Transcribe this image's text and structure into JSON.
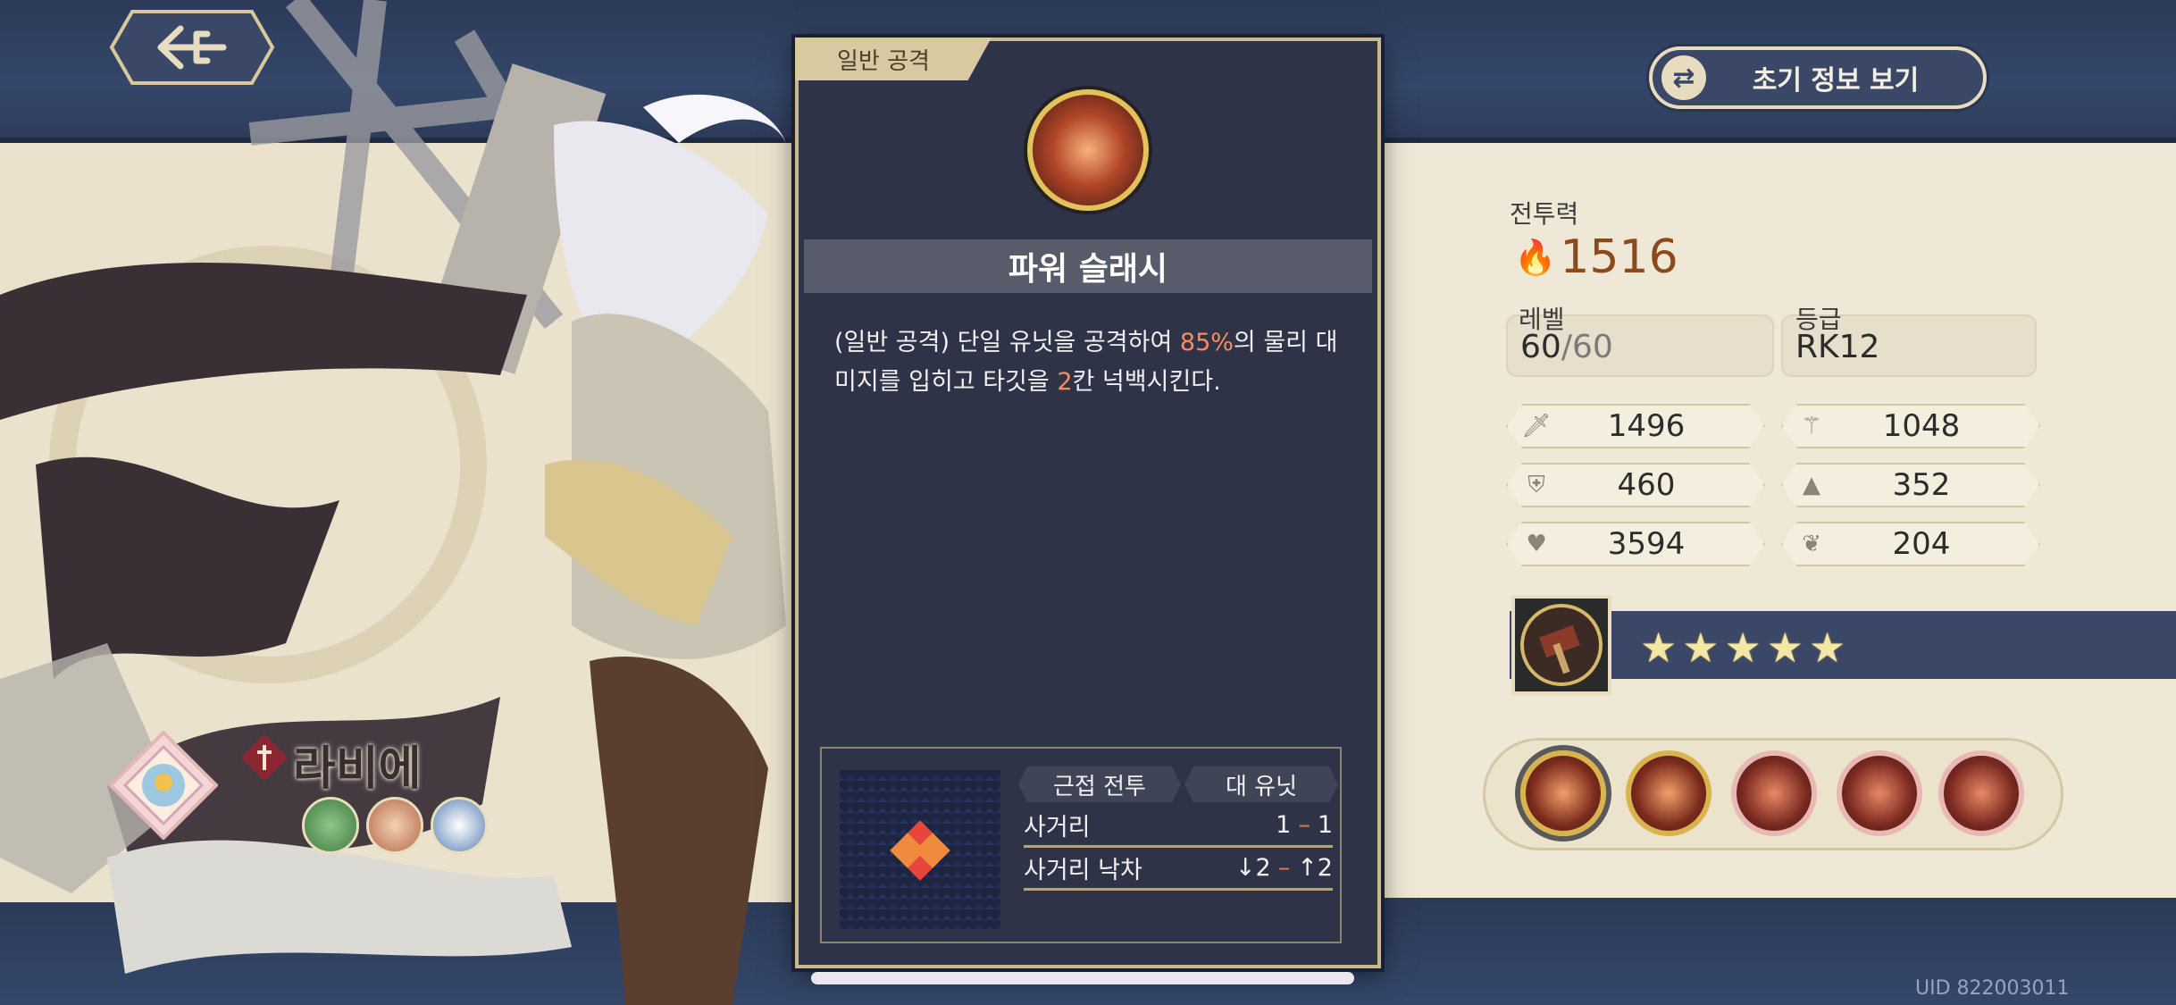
{
  "header": {
    "back_icon": "trident-arrow-icon",
    "init_button": {
      "icon": "swap-arrows-icon",
      "label": "초기 정보 보기"
    }
  },
  "character": {
    "name": "라비에",
    "class_icon": "flower-class-icon",
    "emblems": [
      "green-shield-icon",
      "crown-icon",
      "blue-star-icon"
    ]
  },
  "stats": {
    "combat_power_label": "전투력",
    "combat_power": "1516",
    "level_label": "레벨",
    "level_current": "60",
    "level_max": "/60",
    "grade_label": "등급",
    "grade": "RK12",
    "rows": [
      {
        "left_icon": "sword-icon",
        "left": "1496",
        "right_icon": "wand-icon",
        "right": "1048"
      },
      {
        "left_icon": "shield-icon",
        "left": "460",
        "right_icon": "wizard-hat-icon",
        "right": "352"
      },
      {
        "left_icon": "heart-icon",
        "left": "3594",
        "right_icon": "wing-icon",
        "right": "204"
      }
    ],
    "stars": 5
  },
  "skills": [
    {
      "name": "power-slash-skill-icon",
      "ring": "gold",
      "selected": true
    },
    {
      "name": "skill-2-icon",
      "ring": "gold"
    },
    {
      "name": "skill-3-icon",
      "ring": "rose"
    },
    {
      "name": "skill-4-icon",
      "ring": "rose"
    },
    {
      "name": "skill-5-icon",
      "ring": "rose"
    }
  ],
  "modal": {
    "tab": "일반 공격",
    "title": "파워 슬래시",
    "desc_1": "(일반 공격) 단일 유닛을 공격하여 ",
    "desc_hl1": "85%",
    "desc_2": "의 물리 대미지를 입히고 타깃을 ",
    "desc_hl2": "2",
    "desc_3": "칸 넉백시킨다.",
    "tag_melee": "근접 전투",
    "tag_target": "대 유닛",
    "range_label": "사거리",
    "range_min": "1",
    "range_max": "1",
    "height_label": "사거리 낙차",
    "height_down": "↓2",
    "height_up": "↑2"
  },
  "footer": {
    "uid": "UID 822003011"
  },
  "colors": {
    "accent": "#ff8a5c",
    "panel": "#2e3347",
    "cream": "#efe8d6",
    "gold": "#d8b34e"
  }
}
